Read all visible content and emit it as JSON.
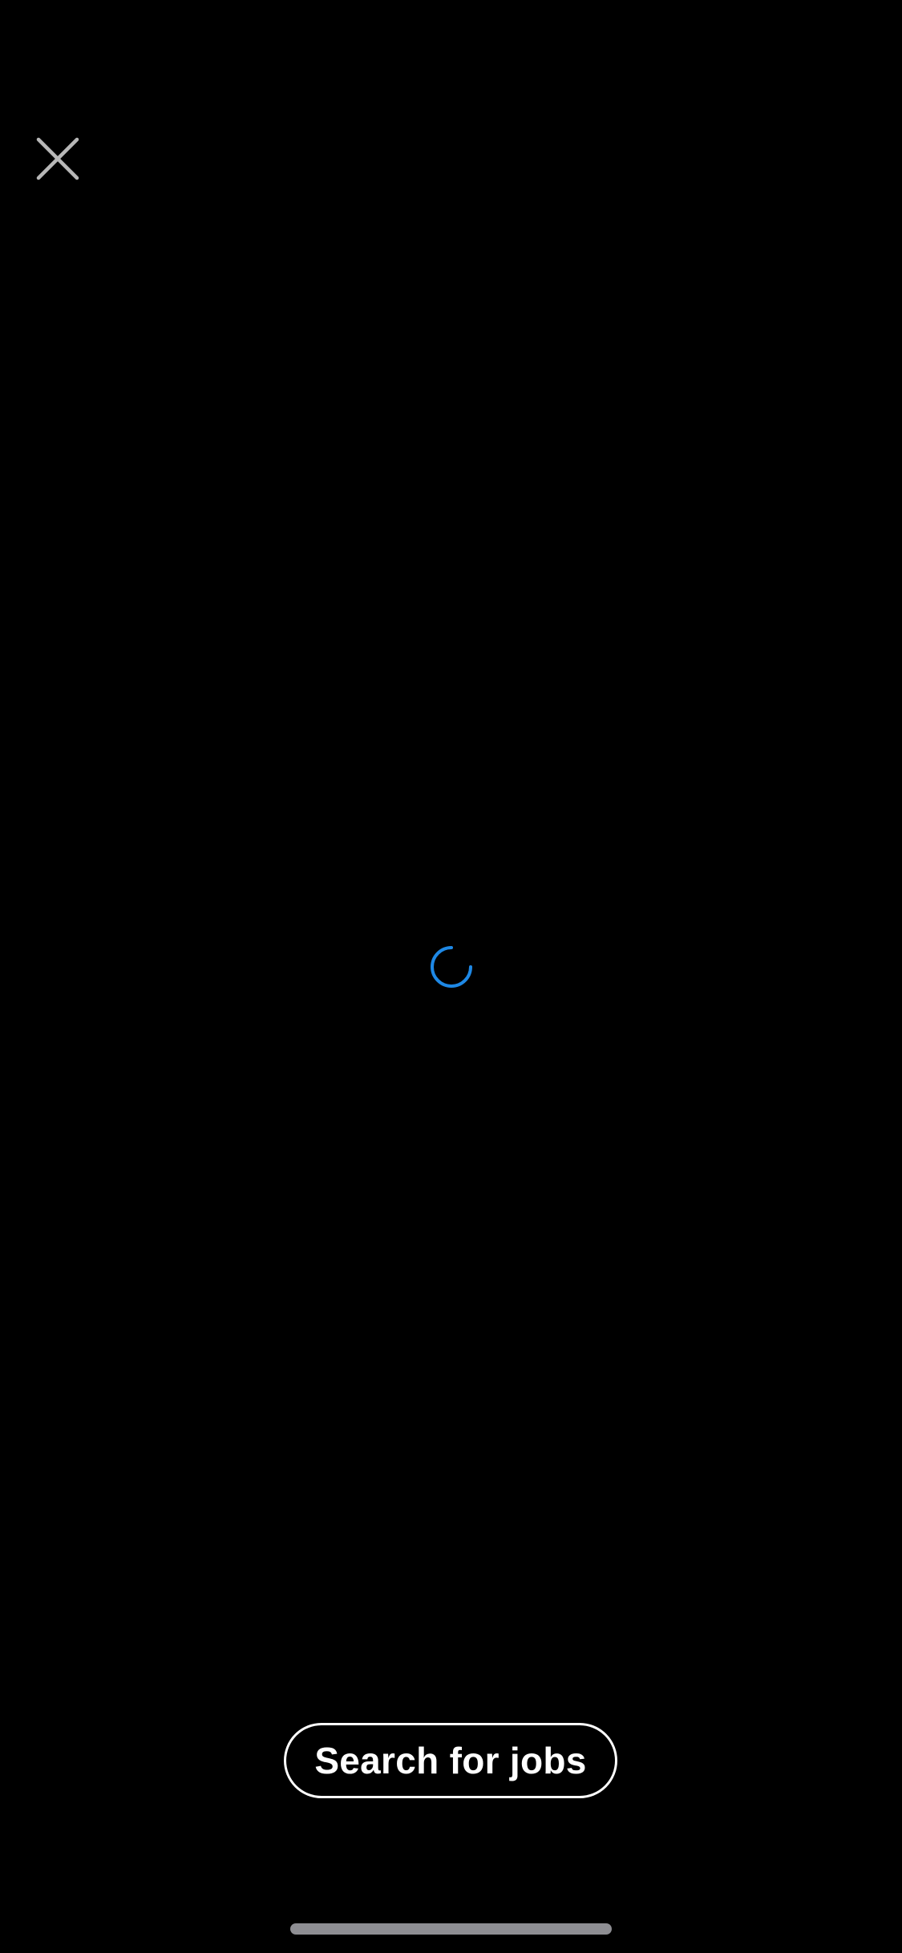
{
  "header": {
    "close_icon": "close-icon"
  },
  "loading": {
    "icon": "loading-spinner-icon",
    "color": "#1E88E5"
  },
  "footer": {
    "search_button_label": "Search for jobs"
  },
  "theme": {
    "background": "#000000",
    "foreground": "#FFFFFF",
    "close_icon_color": "#B8B8B8",
    "home_indicator_color": "#8E8E93"
  }
}
